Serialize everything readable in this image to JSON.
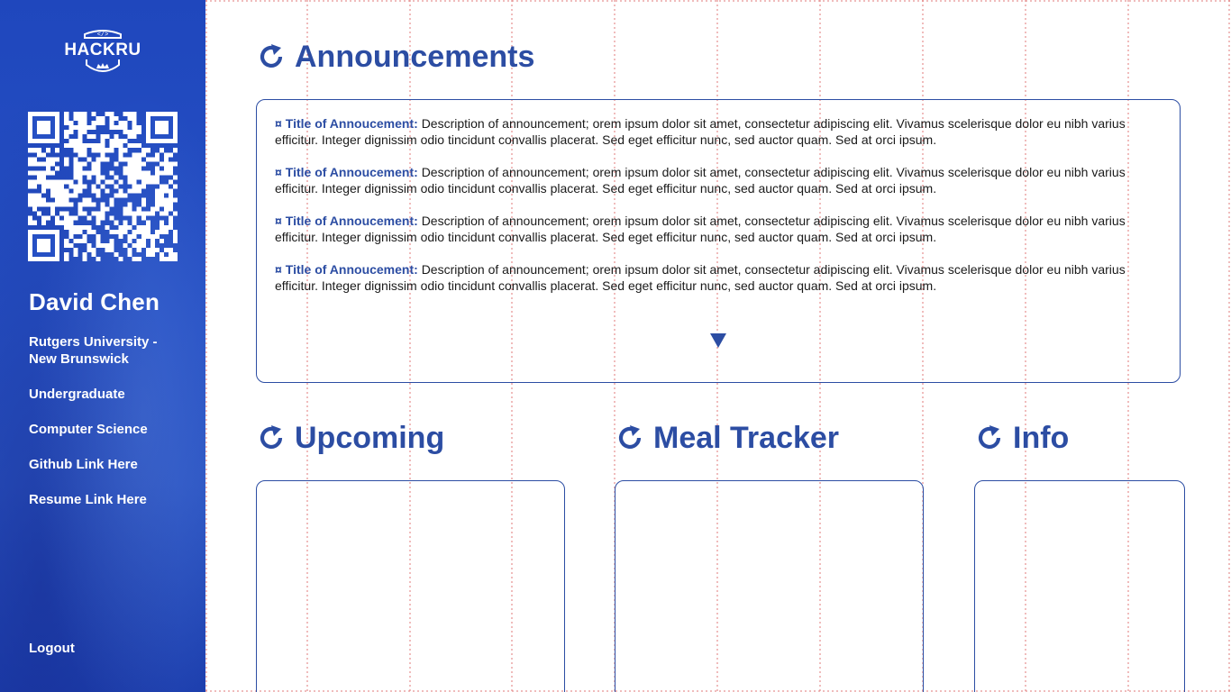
{
  "sidebar": {
    "logo_text": "HACKRU",
    "user_name": "David Chen",
    "links": [
      "Rutgers University - New Brunswick",
      "Undergraduate",
      "Computer Science",
      "Github Link Here",
      "Resume Link Here"
    ],
    "logout": "Logout"
  },
  "announcements": {
    "title": "Announcements",
    "items": [
      {
        "bullet": "¤",
        "title": "Title of Annoucement:",
        "body": "Description of announcement; orem ipsum dolor sit amet, consectetur adipiscing elit. Vivamus scelerisque dolor eu nibh varius efficitur. Integer dignissim odio tincidunt convallis placerat. Sed eget efficitur nunc, sed auctor quam. Sed at orci ipsum."
      },
      {
        "bullet": "¤",
        "title": "Title of Annoucement:",
        "body": "Description of announcement; orem ipsum dolor sit amet, consectetur adipiscing elit. Vivamus scelerisque dolor eu nibh varius efficitur. Integer dignissim odio tincidunt convallis placerat. Sed eget efficitur nunc, sed auctor quam. Sed at orci ipsum."
      },
      {
        "bullet": "¤",
        "title": "Title of Annoucement:",
        "body": "Description of announcement; orem ipsum dolor sit amet, consectetur adipiscing elit. Vivamus scelerisque dolor eu nibh varius efficitur. Integer dignissim odio tincidunt convallis placerat. Sed eget efficitur nunc, sed auctor quam. Sed at orci ipsum."
      },
      {
        "bullet": "¤",
        "title": "Title of Annoucement:",
        "body": "Description of announcement; orem ipsum dolor sit amet, consectetur adipiscing elit. Vivamus scelerisque dolor eu nibh varius efficitur. Integer dignissim odio tincidunt convallis placerat. Sed eget efficitur nunc, sed auctor quam. Sed at orci ipsum."
      }
    ]
  },
  "sections": {
    "upcoming": "Upcoming",
    "meal_tracker": "Meal Tracker",
    "info": "Info"
  },
  "icons": {
    "refresh": "refresh-icon",
    "scroll_down": "triangle-down-icon"
  },
  "colors": {
    "accent": "#2c4da3",
    "sidebar": "#2650c4",
    "guide_lines": "#e07a7a"
  }
}
